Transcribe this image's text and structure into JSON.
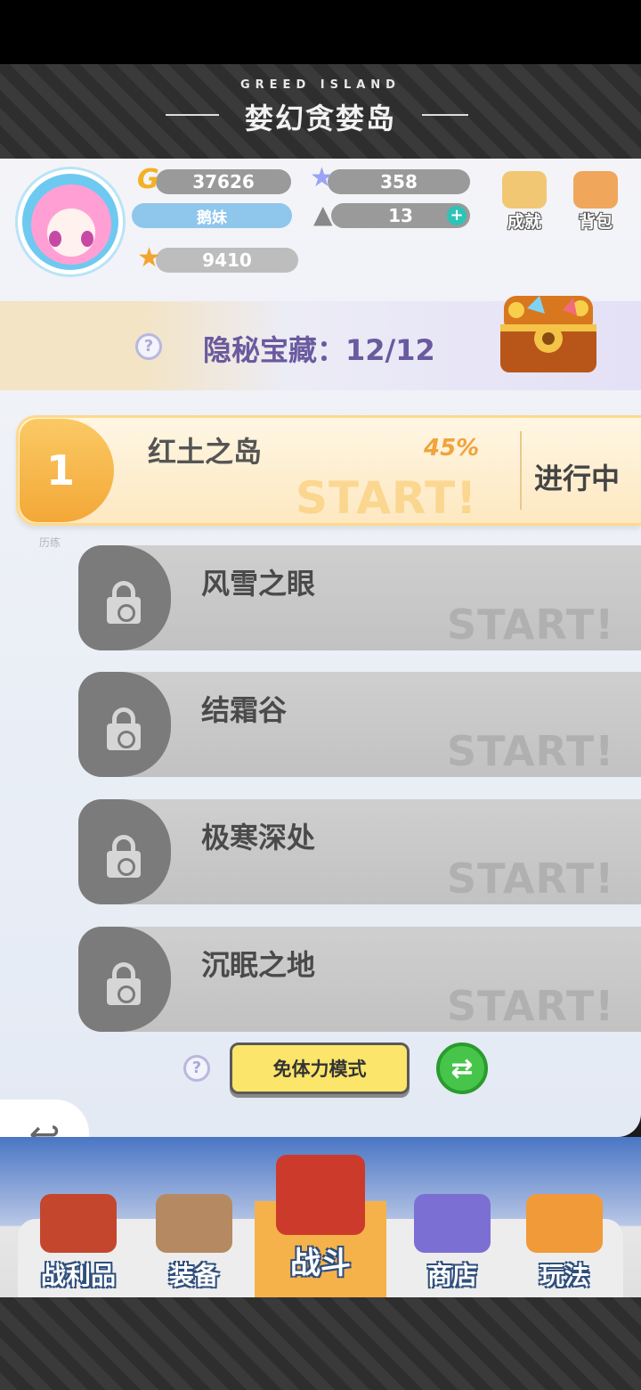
{
  "header": {
    "subtitle": "GREED ISLAND",
    "title": "婪幻贪婪岛"
  },
  "profile": {
    "gold": "37626",
    "stars": "358",
    "name": "鹅妹",
    "stamina": "13",
    "medals": "9410"
  },
  "side_buttons": {
    "achievements": "成就",
    "backpack": "背包"
  },
  "treasure": {
    "label": "隐秘宝藏：12/12"
  },
  "active_level": {
    "number": "1",
    "name": "红土之岛",
    "progress": "45%",
    "start": "START!",
    "status": "进行中",
    "tag": "历练"
  },
  "locked_levels": [
    {
      "name": "风雪之眼",
      "start": "START!"
    },
    {
      "name": "结霜谷",
      "start": "START!"
    },
    {
      "name": "极寒深处",
      "start": "START!"
    },
    {
      "name": "沉眠之地",
      "start": "START!"
    }
  ],
  "controls": {
    "mode_button": "免体力模式",
    "help": "?",
    "back": "⟲"
  },
  "nav": [
    {
      "label": "战利品"
    },
    {
      "label": "装备"
    },
    {
      "label": "战斗"
    },
    {
      "label": "商店"
    },
    {
      "label": "玩法"
    }
  ],
  "colors": {
    "accent_orange": "#f3a837",
    "locked_gray": "#7b7b7b",
    "mode_yellow": "#fbe56a",
    "swap_green": "#47c44a"
  }
}
